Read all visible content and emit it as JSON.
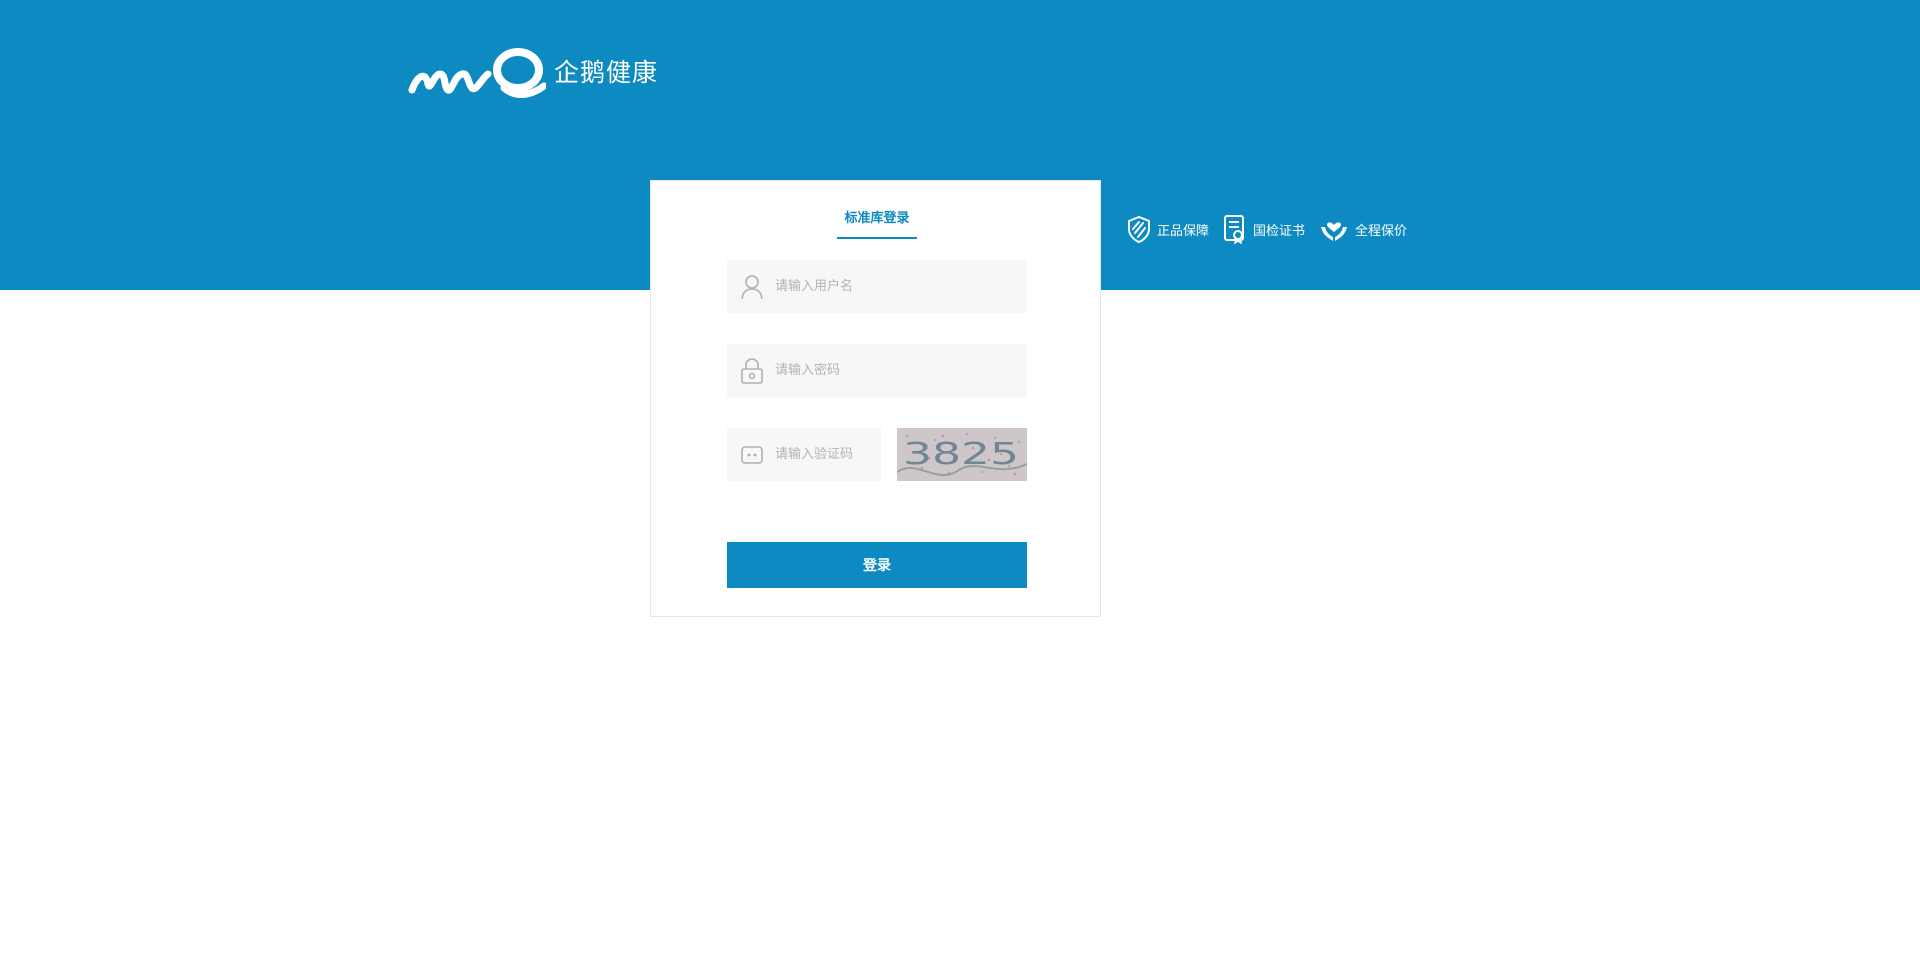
{
  "header": {
    "brand_name": "企鹅健康",
    "badges": [
      {
        "label": "正品保障",
        "icon": "shield-icon"
      },
      {
        "label": "国检证书",
        "icon": "certificate-icon"
      },
      {
        "label": "全程保价",
        "icon": "heart-hands-icon"
      }
    ]
  },
  "login": {
    "tab_label": "标准库登录",
    "username_placeholder": "请输入用户名",
    "password_placeholder": "请输入密码",
    "captcha_placeholder": "请输入验证码",
    "captcha_text": "3825",
    "submit_label": "登录"
  },
  "colors": {
    "brand": "#0d8ac1",
    "field_bg": "#f7f7f7",
    "placeholder": "#b3b3b3"
  }
}
